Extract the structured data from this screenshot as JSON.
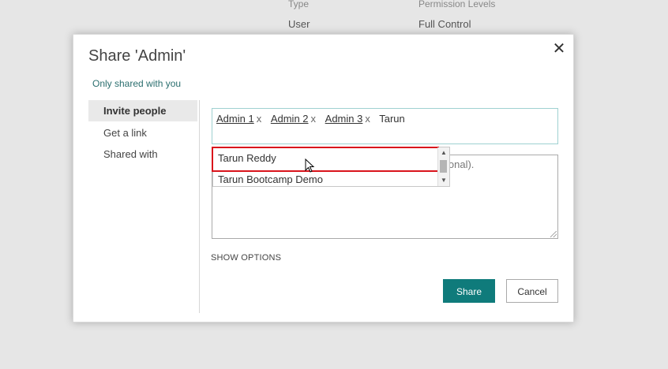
{
  "background": {
    "headers": [
      "Type",
      "Permission Levels"
    ],
    "row": [
      "User",
      "Full Control"
    ]
  },
  "dialog": {
    "title": "Share 'Admin'",
    "close_icon": "close-icon",
    "sharing_status": "Only shared with you",
    "nav": [
      {
        "label": "Invite people",
        "active": true
      },
      {
        "label": "Get a link",
        "active": false
      },
      {
        "label": "Shared with",
        "active": false
      }
    ],
    "people_picker": {
      "chips": [
        {
          "name": "Admin 1",
          "remove": "x"
        },
        {
          "name": "Admin 2",
          "remove": "x"
        },
        {
          "name": "Admin 3",
          "remove": "x"
        }
      ],
      "typed_text": "Tarun"
    },
    "suggestions": [
      "Tarun Reddy",
      "Tarun Bootcamp Demo"
    ],
    "message_placeholder_visible": "ional).",
    "show_options": "SHOW OPTIONS",
    "share_button": "Share",
    "cancel_button": "Cancel"
  },
  "colors": {
    "accent": "#0f7b7b",
    "highlight": "#d9141c"
  }
}
